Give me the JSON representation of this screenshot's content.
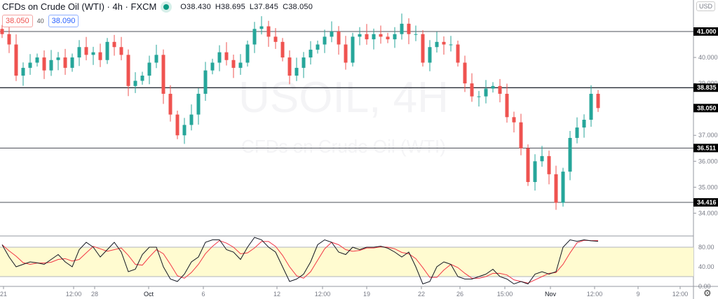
{
  "header": {
    "title": "CFDs on Crude Oil (WTI) · 4h · FXCM",
    "open": "O38.430",
    "high": "H38.695",
    "low": "L37.845",
    "close": "C38.050",
    "sell": "38.050",
    "spread": "40",
    "buy": "38.090",
    "currency": "USD"
  },
  "colors": {
    "up": "#26a69a",
    "down": "#ef5350",
    "stochK": "#131722",
    "stochD": "#f23645",
    "band": "#fffbd0"
  },
  "chart_data": {
    "type": "candlestick",
    "title": "USOIL, 4H",
    "subtitle": "CFDs on Crude Oil (WTI)",
    "ylim": [
      33.4,
      41.75
    ],
    "yticks": [
      "41.000",
      "40.000",
      "39.000",
      "38.000",
      "37.000",
      "36.000",
      "35.000",
      "34.000"
    ],
    "ytick_values": [
      41,
      40,
      39,
      38,
      37,
      36,
      35,
      34
    ],
    "hlines": [
      {
        "value": 41.0,
        "label": "41.000"
      },
      {
        "value": 38.835,
        "label": "38.835"
      },
      {
        "value": 36.511,
        "label": "36.511"
      },
      {
        "value": 34.416,
        "label": "34.416"
      }
    ],
    "last_price": {
      "value": 38.05,
      "label": "38.050"
    },
    "xticks": [
      "21",
      "12:00",
      "28",
      "Oct",
      "6",
      "12",
      "12:00",
      "19",
      "22",
      "26",
      "15:00",
      "Nov",
      "12:00",
      "9",
      "12:00"
    ],
    "closes": [
      40.9,
      40.5,
      39.3,
      39.6,
      39.8,
      40.0,
      39.5,
      39.9,
      40.0,
      39.6,
      40.0,
      40.4,
      40.1,
      40.2,
      39.9,
      40.6,
      40.4,
      40.1,
      38.9,
      39.1,
      39.3,
      39.8,
      40.1,
      38.6,
      37.8,
      37.0,
      37.4,
      37.8,
      38.6,
      39.5,
      39.8,
      40.2,
      39.9,
      39.6,
      39.8,
      40.5,
      41.1,
      41.2,
      40.8,
      40.6,
      40.0,
      39.3,
      39.6,
      40.0,
      40.3,
      40.5,
      40.8,
      41.0,
      40.5,
      39.8,
      40.8,
      40.9,
      40.7,
      40.9,
      40.8,
      40.7,
      40.9,
      41.3,
      40.9,
      40.9,
      39.8,
      40.4,
      40.6,
      40.5,
      40.5,
      39.8,
      39.0,
      38.5,
      38.5,
      38.8,
      38.9,
      38.6,
      37.7,
      37.5,
      36.5,
      35.2,
      36.0,
      36.2,
      35.5,
      34.4,
      35.6,
      36.9,
      37.3,
      37.6,
      38.6,
      38.05
    ],
    "stochastic": {
      "ylim": [
        0,
        100
      ],
      "yticks": [
        "80.00",
        "40.00",
        "0.00"
      ],
      "ytick_values": [
        80,
        40,
        0
      ],
      "band": [
        20,
        80
      ],
      "k": [
        85,
        60,
        40,
        45,
        50,
        48,
        45,
        55,
        65,
        50,
        40,
        75,
        90,
        80,
        60,
        75,
        90,
        70,
        30,
        35,
        65,
        80,
        80,
        40,
        15,
        10,
        25,
        50,
        60,
        90,
        95,
        95,
        75,
        70,
        55,
        80,
        100,
        95,
        80,
        70,
        40,
        10,
        15,
        25,
        50,
        85,
        95,
        90,
        70,
        65,
        80,
        75,
        80,
        80,
        82,
        78,
        70,
        60,
        70,
        40,
        5,
        10,
        40,
        50,
        45,
        20,
        15,
        15,
        20,
        25,
        35,
        20,
        15,
        5,
        10,
        5,
        25,
        30,
        25,
        30,
        80,
        95,
        92,
        95,
        93,
        92
      ]
    }
  }
}
